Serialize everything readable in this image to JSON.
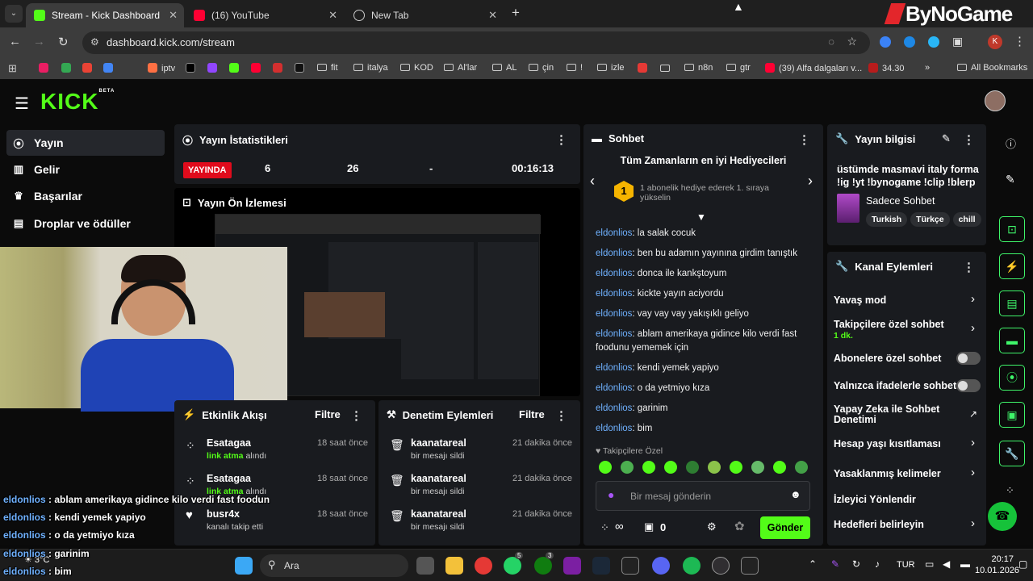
{
  "browser": {
    "tabs": [
      {
        "title": "Stream - Kick Dashboard"
      },
      {
        "title": "(16) YouTube"
      },
      {
        "title": "New Tab"
      }
    ],
    "url": "dashboard.kick.com/stream",
    "bookmarks": [
      "iptv",
      "fit",
      "italya",
      "KOD",
      "Al'lar",
      "AL",
      "çin",
      "!",
      "izle",
      "n8n",
      "gtr",
      "(39) Alfa dalgaları v...",
      "34.30",
      "All Bookmarks"
    ],
    "watermark": "ByNoGame"
  },
  "app": {
    "logo": "KICK",
    "logo_badge": "BETA",
    "nav": [
      {
        "label": "Yayın",
        "icon": "broadcast-icon"
      },
      {
        "label": "Gelir",
        "icon": "chart-icon"
      },
      {
        "label": "Başarılar",
        "icon": "trophy-icon"
      },
      {
        "label": "Droplar ve ödüller",
        "icon": "gift-icon"
      }
    ],
    "stats": {
      "title": "Yayın İstatistikleri",
      "live": "YAYINDA",
      "values": [
        "6",
        "26",
        "-",
        "00:16:13"
      ]
    },
    "preview": {
      "title": "Yayın Ön İzlemesi"
    },
    "chat": {
      "title": "Sohbet",
      "top_gifters": "Tüm Zamanların en iyi Hediyecileri",
      "gifter_rank": "1",
      "gifter_text": "1 abonelik hediye ederek 1. sıraya yükselin",
      "messages": [
        {
          "user": "eldonlios",
          "text": "la salak cocuk"
        },
        {
          "user": "eldonlios",
          "text": "ben bu adamın yayınına girdim tanıştık"
        },
        {
          "user": "eldonlios",
          "text": "donca ile kankştoyum"
        },
        {
          "user": "eldonlios",
          "text": "kickte yayın aciyordu"
        },
        {
          "user": "eldonlios",
          "text": "vay vay vay yakışıklı geliyo"
        },
        {
          "user": "eldonlios",
          "text": "ablam amerikaya gidince kilo verdi fast foodunu yememek için"
        },
        {
          "user": "eldonlios",
          "text": "kendi yemek yapiyo"
        },
        {
          "user": "eldonlios",
          "text": "o da yetmiyo kıza"
        },
        {
          "user": "eldonlios",
          "text": "garinim"
        },
        {
          "user": "eldonlios",
          "text": "bim"
        }
      ],
      "followers_only": "Takipçilere Özel",
      "placeholder": "Bir mesaj gönderin",
      "infinity": "∞",
      "count": "0",
      "send": "Gönder"
    },
    "stream_info": {
      "title": "Yayın bilgisi",
      "stream_title": "üstümde masmavi italy forma !ig !yt !bynogame !clip !blerp",
      "category": "Sadece Sohbet",
      "tags": [
        "Turkish",
        "Türkçe",
        "chill"
      ]
    },
    "channel_actions": {
      "title": "Kanal Eylemleri",
      "items": [
        {
          "label": "Yavaş mod",
          "kind": "chevron"
        },
        {
          "label": "Takipçilere özel sohbet",
          "sub": "1 dk.",
          "kind": "chevron"
        },
        {
          "label": "Abonelere özel sohbet",
          "kind": "toggle"
        },
        {
          "label": "Yalnızca ifadelerle sohbet",
          "kind": "toggle"
        },
        {
          "label": "Yapay Zeka ile Sohbet Denetimi",
          "kind": "external"
        },
        {
          "label": "Hesap yaşı kısıtlaması",
          "kind": "chevron"
        },
        {
          "label": "Yasaklanmış kelimeler",
          "kind": "chevron"
        },
        {
          "label": "İzleyici Yönlendir",
          "kind": "none"
        },
        {
          "label": "Hedefleri belirleyin",
          "kind": "chevron"
        }
      ]
    },
    "activity": {
      "title": "Etkinlik Akışı",
      "filter": "Filtre",
      "rows": [
        {
          "user": "Esatagaa",
          "action_hl": "link atma",
          "action_rest": " alındı",
          "time": "18 saat önce"
        },
        {
          "user": "Esatagaa",
          "action_hl": "link atma",
          "action_rest": " alındı",
          "time": "18 saat önce"
        },
        {
          "user": "busr4x",
          "action_hl": "",
          "action_rest": "kanalı takip etti",
          "time": "18 saat önce"
        }
      ]
    },
    "moderation": {
      "title": "Denetim Eylemleri",
      "filter": "Filtre",
      "rows": [
        {
          "user": "kaanatareal",
          "action": "bir mesajı sildi",
          "time": "21 dakika önce"
        },
        {
          "user": "kaanatareal",
          "action": "bir mesajı sildi",
          "time": "21 dakika önce"
        },
        {
          "user": "kaanatareal",
          "action": "bir mesajı sildi",
          "time": "21 dakika önce"
        }
      ]
    }
  },
  "overlay": {
    "chat": [
      {
        "user": "eldonlios",
        "text": " : ablam amerikaya gidince kilo verdi fast foodun"
      },
      {
        "user": "eldonlios",
        "text": " : kendi yemek yapiyo"
      },
      {
        "user": "eldonlios",
        "text": " : o da yetmiyo kıza"
      },
      {
        "user": "eldonlios",
        "text": " : garinim"
      },
      {
        "user": "eldonlios",
        "text": " : bim"
      }
    ]
  },
  "taskbar": {
    "search": "Ara",
    "weather": "3°C",
    "lang": "TUR",
    "time": "20:17",
    "date": "10.01.2026",
    "badge1": "5",
    "badge2": "3"
  },
  "colors": {
    "accent": "#53fc18",
    "live": "#e00b1c",
    "link": "#6fb1ff"
  }
}
